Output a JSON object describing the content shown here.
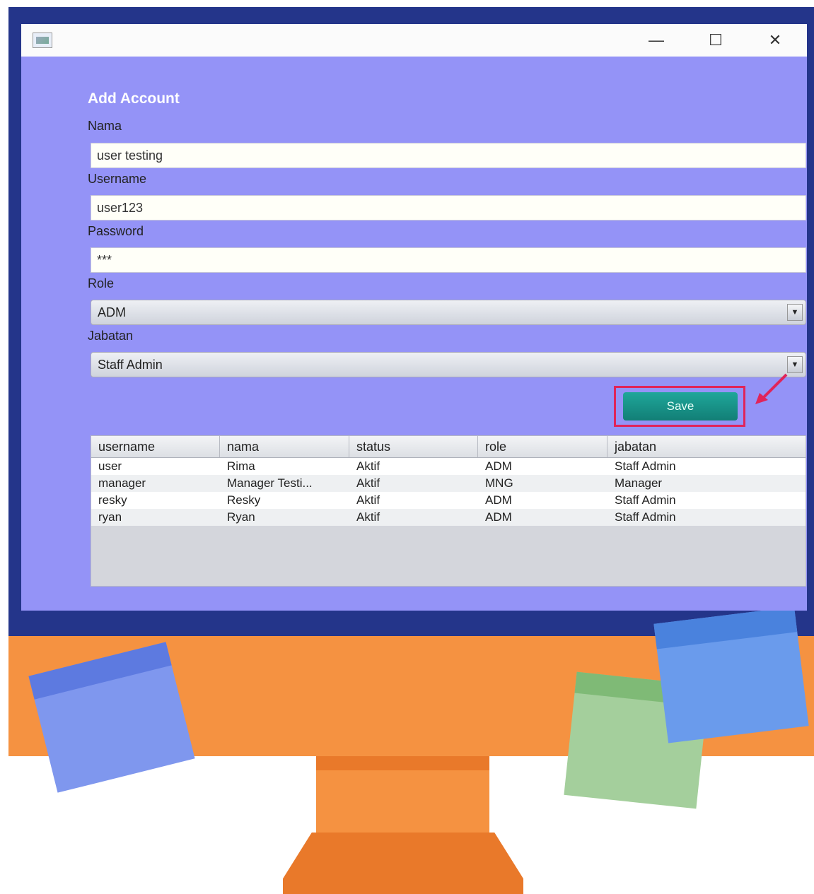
{
  "form": {
    "heading": "Add Account",
    "nama_label": "Nama",
    "nama_value": "user testing",
    "username_label": "Username",
    "username_value": "user123",
    "password_label": "Password",
    "password_value": "***",
    "role_label": "Role",
    "role_value": "ADM",
    "jabatan_label": "Jabatan",
    "jabatan_value": "Staff Admin",
    "save_label": "Save"
  },
  "table": {
    "headers": [
      "username",
      "nama",
      "status",
      "role",
      "jabatan"
    ],
    "rows": [
      [
        "user",
        "Rima",
        "Aktif",
        "ADM",
        "Staff Admin"
      ],
      [
        "manager",
        "Manager Testi...",
        "Aktif",
        "MNG",
        "Manager"
      ],
      [
        "resky",
        "Resky",
        "Aktif",
        "ADM",
        "Staff Admin"
      ],
      [
        "ryan",
        "Ryan",
        "Aktif",
        "ADM",
        "Staff Admin"
      ]
    ]
  },
  "window_controls": {
    "minimize": "—",
    "maximize": "☐",
    "close": "✕"
  },
  "icons": {
    "app": "app-icon",
    "dropdown": "▼"
  },
  "colors": {
    "window_bg": "#9493f7",
    "bezel": "#24358a",
    "save_button": "#1a9a8e",
    "highlight": "#e0245a",
    "monitor_body": "#f59241"
  }
}
